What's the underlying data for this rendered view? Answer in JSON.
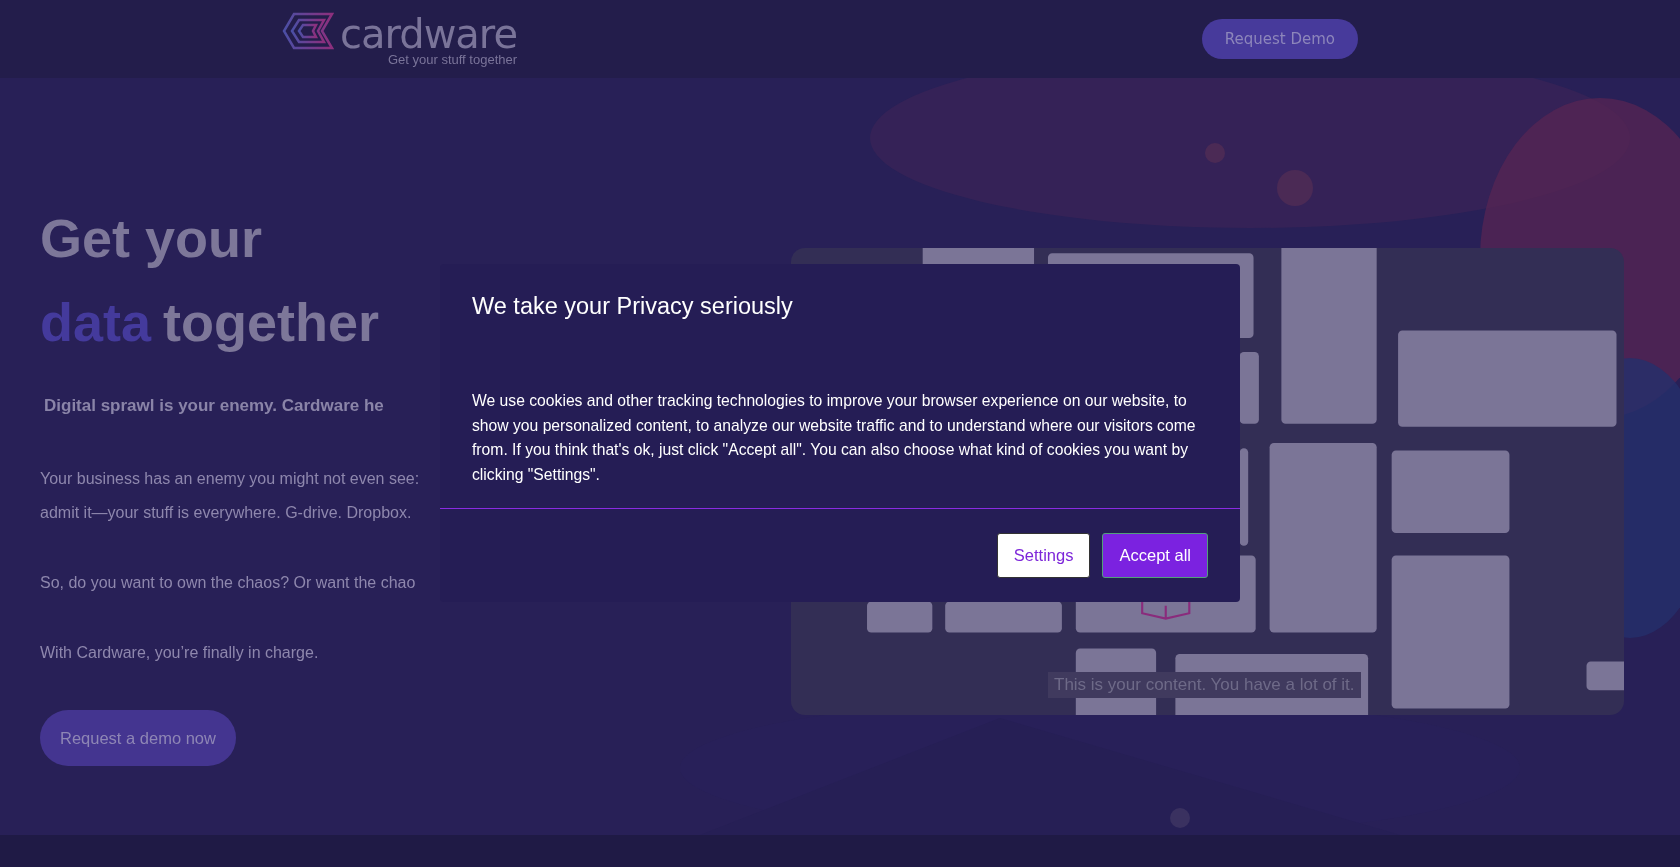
{
  "header": {
    "logo": {
      "name": "cardware",
      "tagline": "Get your stuff together"
    },
    "cta": "Request Demo"
  },
  "hero": {
    "headline_line_1": "Get your",
    "headline_highlight": "data",
    "headline_rest": "together",
    "subheading": "Digital sprawl is your enemy. Cardware he",
    "paragraphs": [
      {
        "lines": [
          "Your business has an enemy you might not even see:",
          "admit it—your stuff is everywhere. G-drive. Dropbox."
        ]
      },
      {
        "lines": [
          "So, do you want to own the chaos? Or want the chao"
        ]
      },
      {
        "lines": [
          "With Cardware, you’re finally in charge."
        ]
      }
    ],
    "button": "Request a demo now"
  },
  "showcase": {
    "caption": "This is your content. You have a lot of it."
  },
  "cookie_dialog": {
    "title": "We take your Privacy seriously",
    "body": "We use cookies and other tracking technologies to improve your browser experience on our website, to show you personalized content, to analyze our website traffic and to understand where our visitors come from. If you think that's ok, just click \"Accept all\". You can also choose what kind of cookies you want by clicking \"Settings\".",
    "buttons": [
      {
        "label": "Settings",
        "kind": "secondary"
      },
      {
        "label": "Accept all",
        "kind": "primary"
      }
    ]
  }
}
